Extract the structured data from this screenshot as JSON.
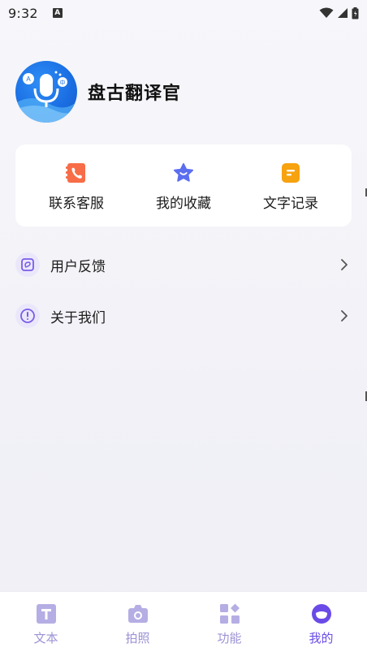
{
  "status_bar": {
    "time": "9:32",
    "notification_icon": "a-icon",
    "wifi_icon": "wifi-icon",
    "signal_icon": "signal-icon",
    "battery_icon": "battery-icon"
  },
  "profile": {
    "avatar_icon": "app-logo-mic-icon",
    "app_name": "盘古翻译官"
  },
  "quick_actions": [
    {
      "label": "联系客服",
      "icon": "phone-book-icon",
      "color": "#f76d48"
    },
    {
      "label": "我的收藏",
      "icon": "star-icon",
      "color": "#5b6ef0"
    },
    {
      "label": "文字记录",
      "icon": "note-icon",
      "color": "#f7a20f"
    }
  ],
  "menu": [
    {
      "label": "用户反馈",
      "icon": "feedback-icon"
    },
    {
      "label": "关于我们",
      "icon": "info-icon"
    }
  ],
  "bottom_nav": [
    {
      "label": "文本",
      "icon": "text-icon",
      "active": false
    },
    {
      "label": "拍照",
      "icon": "camera-icon",
      "active": false
    },
    {
      "label": "功能",
      "icon": "grid-icon",
      "active": false
    },
    {
      "label": "我的",
      "icon": "profile-icon",
      "active": true
    }
  ],
  "colors": {
    "accent": "#6a4be7",
    "nav_inactive": "#9b93d6",
    "menu_icon": "#7a5ce8",
    "card_bg": "#ffffff",
    "page_bg": "#f3f3f8"
  }
}
